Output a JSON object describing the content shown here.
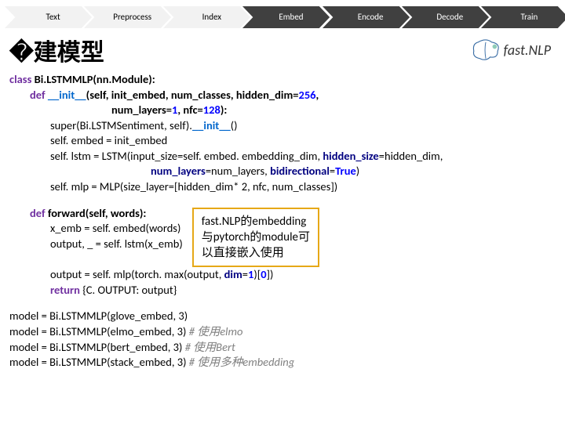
{
  "pipeline": {
    "steps": [
      {
        "label": "Text",
        "fill": "#f2f2f2",
        "text": "#000"
      },
      {
        "label": "Preprocess",
        "fill": "#f2f2f2",
        "text": "#000"
      },
      {
        "label": "Index",
        "fill": "#f2f2f2",
        "text": "#000"
      },
      {
        "label": "Embed",
        "fill": "#404040",
        "text": "#fff"
      },
      {
        "label": "Encode",
        "fill": "#404040",
        "text": "#fff"
      },
      {
        "label": "Decode",
        "fill": "#404040",
        "text": "#fff"
      },
      {
        "label": "Train",
        "fill": "#404040",
        "text": "#fff"
      }
    ]
  },
  "title": "�建模型",
  "logo_text": "fast.NLP",
  "code": {
    "l1_class": "class",
    "l1_name": " Bi.LSTMMLP(nn.Module):",
    "l2_def": "def",
    "l2_init": " __init__",
    "l2_args1": "(self, init_embed,  num_classes,  hidden_dim=",
    "l2_num1": "256",
    "l2_args2": ",",
    "l3_args": "num_layers=",
    "l3_num1": "1",
    "l3_mid": ", nfc=",
    "l3_num2": "128",
    "l3_end": "):",
    "l4": "super(Bi.LSTMSentiment, self).",
    "l4_init": "__init__",
    "l4_end": "()",
    "l5": "self. embed = init_embed",
    "l6a": "self. lstm = LSTM(input_size=self. embed. embedding_dim, ",
    "l6b": "hidden_size",
    "l6c": "=hidden_dim,",
    "l7a": "num_layers",
    "l7b": "=num_layers, ",
    "l7c": "bidirectional",
    "l7d": "=",
    "l7e": "True",
    "l7f": ")",
    "l8": "self. mlp = MLP(size_layer=[hidden_dim* 2, nfc, num_classes])",
    "f1_def": "def",
    "f1_name": " forward(self, words):",
    "f2": "x_emb = self. embed(words)",
    "f3": "output, _ = self. lstm(x_emb)",
    "f4a": "output = self. mlp(torch. max(output, ",
    "f4b": "dim",
    "f4c": "=",
    "f4d": "1",
    "f4e": ")[",
    "f4f": "0",
    "f4g": "])",
    "f5a": "return",
    "f5b": " {C. OUTPUT: output}",
    "m1": "model = Bi.LSTMMLP(glove_embed, 3)",
    "m2a": "model = Bi.LSTMMLP(elmo_embed, 3)  ",
    "m2b": "# 使用elmo",
    "m3a": "model = Bi.LSTMMLP(bert_embed, 3)  ",
    "m3b": "# 使用Bert",
    "m4a": "model = Bi.LSTMMLP(stack_embed, 3)  ",
    "m4b": "# 使用多种embedding"
  },
  "callout": {
    "line1": "fast.NLP的embedding",
    "line2": "与pytorch的module可",
    "line3": "以直接嵌入使用"
  }
}
